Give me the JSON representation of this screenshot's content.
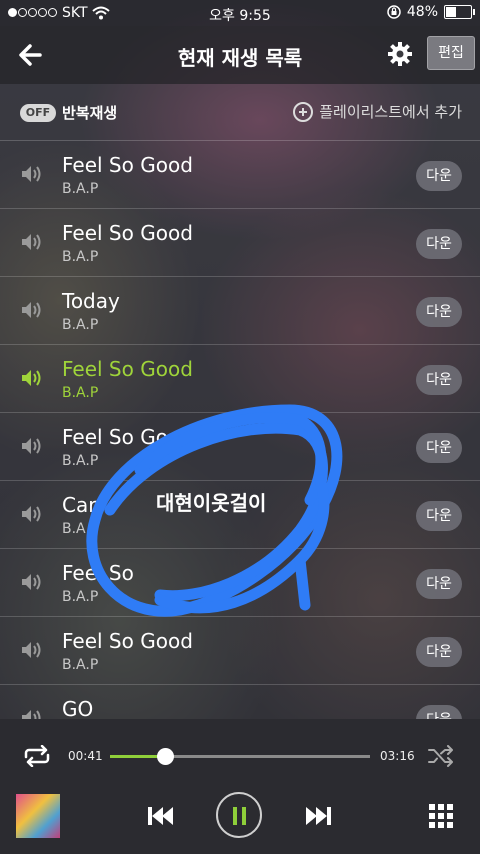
{
  "status": {
    "carrier": "SKT",
    "time": "오후 9:55",
    "battery": "48%",
    "battery_level": 0.48
  },
  "header": {
    "title": "현재 재생 목록",
    "edit_label": "편집"
  },
  "toolbar": {
    "toggle_label": "OFF",
    "repeat_label": "반복재생",
    "add_label": "플레이리스트에서 추가"
  },
  "tracks": [
    {
      "title": "Feel So Good",
      "artist": "B.A.P",
      "action": "다운"
    },
    {
      "title": "Feel So Good",
      "artist": "B.A.P",
      "action": "다운"
    },
    {
      "title": "Today",
      "artist": "B.A.P",
      "action": "다운"
    },
    {
      "title": "Feel So Good",
      "artist": "B.A.P",
      "action": "다운",
      "active": true
    },
    {
      "title": "Feel So Goo",
      "artist": "B.A.P",
      "action": "다운"
    },
    {
      "title": "Car",
      "artist": "B.A",
      "action": "다운"
    },
    {
      "title": "Feel So",
      "artist": "B.A.P",
      "action": "다운"
    },
    {
      "title": "Feel So Good",
      "artist": "B.A.P",
      "action": "다운"
    },
    {
      "title": "GO",
      "artist": "",
      "action": "다운"
    }
  ],
  "player": {
    "current_time": "00:41",
    "total_time": "03:16",
    "progress": 0.21
  },
  "annotation": {
    "text": "대현이옷걸이"
  },
  "colors": {
    "accent": "#9fd43a",
    "annotation": "#2f7cf6"
  }
}
